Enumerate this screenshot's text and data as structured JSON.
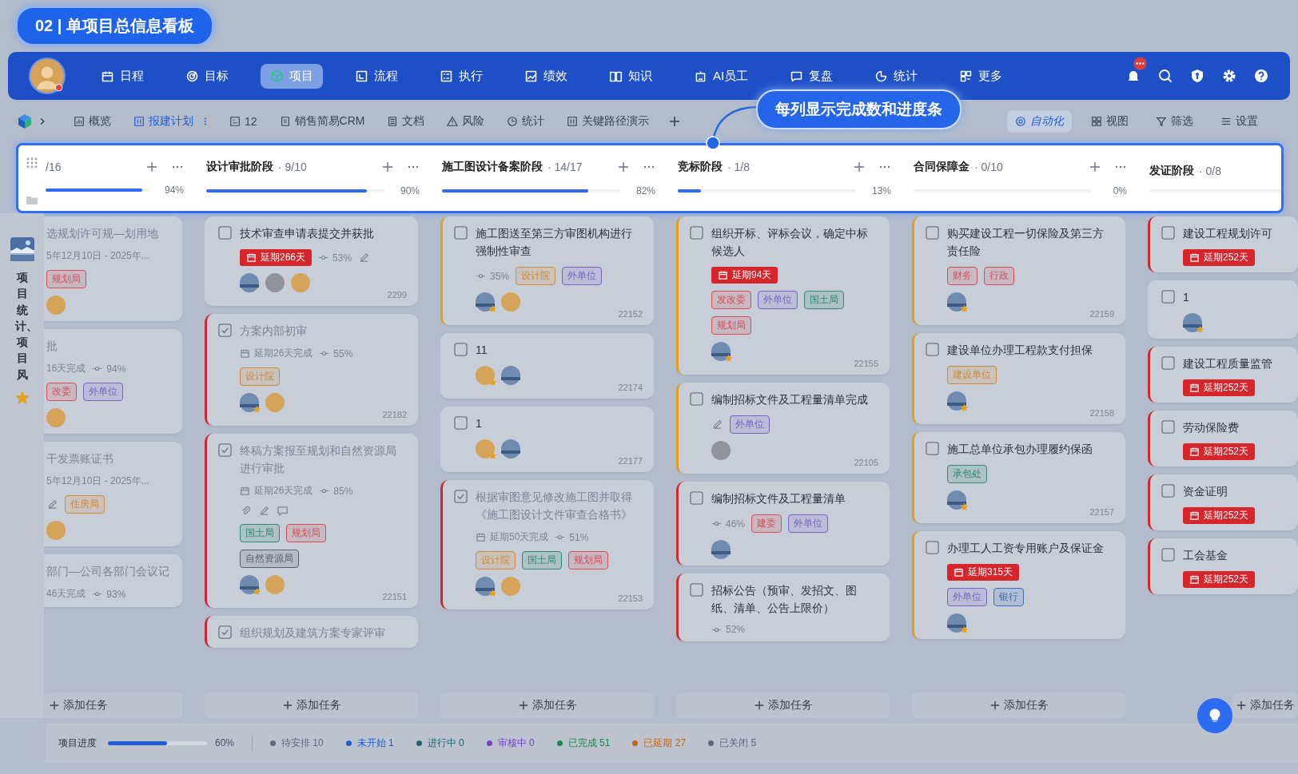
{
  "title_badge": "02 | 单项目总信息看板",
  "nav": {
    "items": [
      {
        "label": "日程",
        "selected": false
      },
      {
        "label": "目标",
        "selected": false
      },
      {
        "label": "项目",
        "selected": true
      },
      {
        "label": "流程",
        "selected": false
      },
      {
        "label": "执行",
        "selected": false
      },
      {
        "label": "绩效",
        "selected": false
      },
      {
        "label": "知识",
        "selected": false
      },
      {
        "label": "AI员工",
        "selected": false
      },
      {
        "label": "复盘",
        "selected": false
      },
      {
        "label": "统计",
        "selected": false
      },
      {
        "label": "更多",
        "selected": false
      }
    ],
    "notifications": true
  },
  "toolbar": {
    "tabs": [
      {
        "label": "概览",
        "selected": false
      },
      {
        "label": "报建计划",
        "selected": true
      },
      {
        "label": "12",
        "selected": false
      },
      {
        "label": "销售简易CRM",
        "selected": false
      },
      {
        "label": "文档",
        "selected": false
      },
      {
        "label": "风险",
        "selected": false
      },
      {
        "label": "统计",
        "selected": false
      },
      {
        "label": "关键路径演示",
        "selected": false
      }
    ],
    "actions": [
      {
        "label": "自动化",
        "selected": true
      },
      {
        "label": "视图",
        "selected": false
      },
      {
        "label": "筛选",
        "selected": false
      },
      {
        "label": "设置",
        "selected": false
      }
    ]
  },
  "callout": "每列显示完成数和进度条",
  "sidebar": {
    "label": "项目统计、项目风",
    "starred": true
  },
  "columns": [
    {
      "count": "/16",
      "level": 0.94,
      "percent": "94%",
      "add_label": "添加任务",
      "cards": [
        {
          "title": "选规划许可规—划用地",
          "done": true,
          "lines": [
            {
              "items": [
                {
                  "kind": "date",
                  "text": "5年12月10日 - 2025年..."
                }
              ]
            },
            {
              "items": [
                {
                  "kind": "tag",
                  "text": "规划局",
                  "color": "#d2505a"
                }
              ]
            }
          ],
          "avatars": [
            {
              "kind": "bear"
            }
          ]
        },
        {
          "title": "批",
          "done": true,
          "lines": [
            {
              "items": [
                {
                  "kind": "date",
                  "text": "16天完成"
                },
                {
                  "kind": "progress",
                  "text": "94%"
                }
              ]
            },
            {
              "items": [
                {
                  "kind": "tag",
                  "text": "改委",
                  "color": "#d2505a"
                },
                {
                  "kind": "tag",
                  "text": "外单位",
                  "color": "#7a62c8"
                }
              ]
            }
          ],
          "avatars": [
            {
              "kind": "bear"
            }
          ]
        },
        {
          "title": "干发票账证书",
          "done": true,
          "lines": [
            {
              "items": [
                {
                  "kind": "date",
                  "text": "5年12月10日 - 2025年..."
                }
              ]
            },
            {
              "items": [
                {
                  "kind": "edit"
                },
                {
                  "kind": "tag",
                  "text": "住房局",
                  "color": "#d08a3a"
                }
              ]
            }
          ],
          "avatars": [
            {
              "kind": "bear"
            }
          ]
        },
        {
          "title": "部门—公司各部门会议记",
          "done": true,
          "lines": [
            {
              "items": [
                {
                  "kind": "date",
                  "text": "46天完成"
                },
                {
                  "kind": "progress",
                  "text": "93%"
                }
              ]
            }
          ]
        }
      ]
    },
    {
      "name": "设计审批阶段",
      "count": "· 9/10",
      "level": 0.9,
      "percent": "90%",
      "add_label": "添加任务",
      "cards": [
        {
          "title": "技术审查申请表提交并获批",
          "done": false,
          "lines": [
            {
              "items": [
                {
                  "kind": "delay",
                  "text": "延期266天"
                },
                {
                  "kind": "progress",
                  "text": "53%"
                },
                {
                  "kind": "edit"
                }
              ]
            }
          ],
          "avatars": [
            {
              "kind": "sea"
            },
            {
              "kind": "gray"
            },
            {
              "kind": "bear"
            }
          ],
          "id": "2299"
        },
        {
          "title": "方案内部初审",
          "done": true,
          "color": "#d3262e",
          "lines": [
            {
              "items": [
                {
                  "kind": "due",
                  "text": "延期26天完成"
                },
                {
                  "kind": "progress",
                  "text": "55%"
                }
              ]
            },
            {
              "items": [
                {
                  "kind": "tag",
                  "text": "设计院",
                  "color": "#d08a3a"
                }
              ]
            }
          ],
          "avatars": [
            {
              "kind": "sea",
              "starred": true
            },
            {
              "kind": "bear"
            }
          ],
          "id": "22182"
        },
        {
          "title": "终稿方案报至规划和自然资源局进行审批",
          "done": true,
          "color": "#d3262e",
          "lines": [
            {
              "items": [
                {
                  "kind": "due",
                  "text": "延期26天完成"
                },
                {
                  "kind": "progress",
                  "text": "85%"
                }
              ]
            },
            {
              "items": [
                {
                  "kind": "attach"
                },
                {
                  "kind": "edit"
                },
                {
                  "kind": "comment"
                }
              ]
            },
            {
              "items": [
                {
                  "kind": "tag",
                  "text": "国土局",
                  "color": "#2e8a70"
                },
                {
                  "kind": "tag",
                  "text": "规划局",
                  "color": "#d2505a"
                }
              ]
            },
            {
              "items": [
                {
                  "kind": "tag",
                  "text": "自然资源局",
                  "color": "#5a6270"
                }
              ]
            }
          ],
          "avatars": [
            {
              "kind": "sea",
              "starred": true
            },
            {
              "kind": "bear"
            }
          ],
          "id": "22151"
        },
        {
          "title": "组织规划及建筑方案专家评审",
          "done": true,
          "color": "#d3262e"
        }
      ]
    },
    {
      "name": "施工图设计备案阶段",
      "count": "· 14/17",
      "level": 0.82,
      "percent": "82%",
      "add_label": "添加任务",
      "cards": [
        {
          "title": "施工图送至第三方审图机构进行强制性审查",
          "done": false,
          "color": "#e3a01c",
          "lines": [
            {
              "items": [
                {
                  "kind": "progress",
                  "text": "35%"
                },
                {
                  "kind": "tag",
                  "text": "设计院",
                  "color": "#d08a3a"
                },
                {
                  "kind": "tag",
                  "text": "外单位",
                  "color": "#7a62c8"
                }
              ]
            }
          ],
          "avatars": [
            {
              "kind": "sea",
              "starred": true
            },
            {
              "kind": "bear"
            }
          ],
          "id": "22152"
        },
        {
          "title": "11",
          "done": false,
          "avatars": [
            {
              "kind": "bear",
              "starred": true
            },
            {
              "kind": "sea"
            }
          ],
          "id": "22174"
        },
        {
          "title": "1",
          "done": false,
          "avatars": [
            {
              "kind": "bear",
              "starred": true
            },
            {
              "kind": "sea"
            }
          ],
          "id": "22177"
        },
        {
          "title": "根据审图意见修改施工图并取得《施工图设计文件审查合格书》",
          "done": true,
          "color": "#d3262e",
          "lines": [
            {
              "items": [
                {
                  "kind": "due",
                  "text": "延期50天完成"
                },
                {
                  "kind": "progress",
                  "text": "51%"
                }
              ]
            },
            {
              "items": [
                {
                  "kind": "tag",
                  "text": "设计院",
                  "color": "#d08a3a"
                },
                {
                  "kind": "tag",
                  "text": "国土局",
                  "color": "#2e8a70"
                },
                {
                  "kind": "tag",
                  "text": "规划局",
                  "color": "#d2505a"
                }
              ]
            }
          ],
          "avatars": [
            {
              "kind": "sea",
              "starred": true
            },
            {
              "kind": "bear"
            }
          ],
          "id": "22153"
        }
      ]
    },
    {
      "name": "竞标阶段",
      "count": "· 1/8",
      "level": 0.13,
      "percent": "13%",
      "add_label": "添加任务",
      "cards": [
        {
          "title": "组织开标、评标会议，确定中标候选人",
          "done": false,
          "color": "#e3a01c",
          "lines": [
            {
              "items": [
                {
                  "kind": "delay",
                  "text": "延期94天"
                }
              ]
            },
            {
              "items": [
                {
                  "kind": "tag",
                  "text": "发改委",
                  "color": "#d2505a"
                },
                {
                  "kind": "tag",
                  "text": "外单位",
                  "color": "#7a62c8"
                },
                {
                  "kind": "tag",
                  "text": "国土局",
                  "color": "#2e8a70"
                }
              ]
            },
            {
              "items": [
                {
                  "kind": "tag",
                  "text": "规划局",
                  "color": "#d2505a"
                }
              ]
            }
          ],
          "avatars": [
            {
              "kind": "sea",
              "starred": true
            }
          ],
          "id": "22155"
        },
        {
          "title": "编制招标文件及工程量清单完成",
          "done": false,
          "color": "#e3a01c",
          "lines": [
            {
              "items": [
                {
                  "kind": "edit"
                },
                {
                  "kind": "tag",
                  "text": "外单位",
                  "color": "#7a62c8"
                }
              ]
            }
          ],
          "avatars": [
            {
              "kind": "gray"
            }
          ],
          "id": "22105"
        },
        {
          "title": "编制招标文件及工程量清单",
          "done": false,
          "color": "#d3262e",
          "lines": [
            {
              "items": [
                {
                  "kind": "progress",
                  "text": "46%"
                },
                {
                  "kind": "tag",
                  "text": "建委",
                  "color": "#d2505a"
                },
                {
                  "kind": "tag",
                  "text": "外单位",
                  "color": "#7a62c8"
                }
              ]
            }
          ],
          "avatars": [
            {
              "kind": "sea"
            }
          ]
        },
        {
          "title": "招标公告（预审、发招文、图纸、清单、公告上限价）",
          "done": false,
          "color": "#d3262e",
          "lines": [
            {
              "items": [
                {
                  "kind": "progress",
                  "text": "52%"
                }
              ]
            }
          ]
        }
      ]
    },
    {
      "name": "合同保障金",
      "count": "· 0/10",
      "level": 0,
      "percent": "0%",
      "add_label": "添加任务",
      "cards": [
        {
          "title": "购买建设工程一切保险及第三方责任险",
          "done": false,
          "color": "#e3a01c",
          "lines": [
            {
              "items": [
                {
                  "kind": "tag",
                  "text": "财务",
                  "color": "#d2505a"
                },
                {
                  "kind": "tag",
                  "text": "行政",
                  "color": "#d2505a"
                }
              ]
            }
          ],
          "avatars": [
            {
              "kind": "sea",
              "starred": true
            }
          ],
          "id": "22159"
        },
        {
          "title": "建设单位办理工程款支付担保",
          "done": false,
          "color": "#e3a01c",
          "lines": [
            {
              "items": [
                {
                  "kind": "tag",
                  "text": "建设单位",
                  "color": "#d08a3a"
                }
              ]
            }
          ],
          "avatars": [
            {
              "kind": "sea",
              "starred": true
            }
          ],
          "id": "22158"
        },
        {
          "title": "施工总单位承包办理履约保函",
          "done": false,
          "color": "#e3a01c",
          "lines": [
            {
              "items": [
                {
                  "kind": "tag",
                  "text": "承包处",
                  "color": "#2e8a70"
                }
              ]
            }
          ],
          "avatars": [
            {
              "kind": "sea",
              "starred": true
            }
          ],
          "id": "22157"
        },
        {
          "title": "办理工人工资专用账户及保证金",
          "done": false,
          "color": "#e3a01c",
          "lines": [
            {
              "items": [
                {
                  "kind": "delay",
                  "text": "延期315天"
                }
              ]
            },
            {
              "items": [
                {
                  "kind": "tag",
                  "text": "外单位",
                  "color": "#7a62c8"
                },
                {
                  "kind": "tag",
                  "text": "银行",
                  "color": "#3f6fc0"
                }
              ]
            }
          ],
          "avatars": [
            {
              "kind": "sea",
              "starred": true
            }
          ]
        }
      ]
    },
    {
      "name": "发证阶段",
      "count": "· 0/8",
      "level": 0,
      "add_label": "添加任务",
      "cards": [
        {
          "title": "建设工程规划许可",
          "done": false,
          "color": "#d3262e",
          "lines": [
            {
              "items": [
                {
                  "kind": "delay",
                  "text": "延期252天"
                }
              ]
            }
          ]
        },
        {
          "title": "1",
          "done": false,
          "avatars": [
            {
              "kind": "sea",
              "starred": true
            }
          ]
        },
        {
          "title": "建设工程质量监管",
          "done": false,
          "color": "#d3262e",
          "lines": [
            {
              "items": [
                {
                  "kind": "delay",
                  "text": "延期252天"
                }
              ]
            }
          ]
        },
        {
          "title": "劳动保险费",
          "done": false,
          "color": "#d3262e",
          "lines": [
            {
              "items": [
                {
                  "kind": "delay",
                  "text": "延期252天"
                }
              ]
            }
          ]
        },
        {
          "title": "资金证明",
          "done": false,
          "color": "#d3262e",
          "lines": [
            {
              "items": [
                {
                  "kind": "delay",
                  "text": "延期252天"
                }
              ]
            }
          ]
        },
        {
          "title": "工会基金",
          "done": false,
          "color": "#d3262e",
          "lines": [
            {
              "items": [
                {
                  "kind": "delay",
                  "text": "延期252天"
                }
              ]
            }
          ]
        }
      ]
    }
  ],
  "footer": {
    "label": "项目进度",
    "level": 0.6,
    "percent": "60%",
    "stats": [
      {
        "label": "待安排 10",
        "color": "#5f6879"
      },
      {
        "label": "未开始 1",
        "color": "#1c5fd6"
      },
      {
        "label": "进行中 0",
        "color": "#0f6b6b"
      },
      {
        "label": "审核中 0",
        "color": "#7a3fd0"
      },
      {
        "label": "已完成 51",
        "color": "#1e8a4a"
      },
      {
        "label": "已延期 27",
        "color": "#c8650f"
      },
      {
        "label": "已关闭 5",
        "color": "#5f6879"
      }
    ]
  }
}
